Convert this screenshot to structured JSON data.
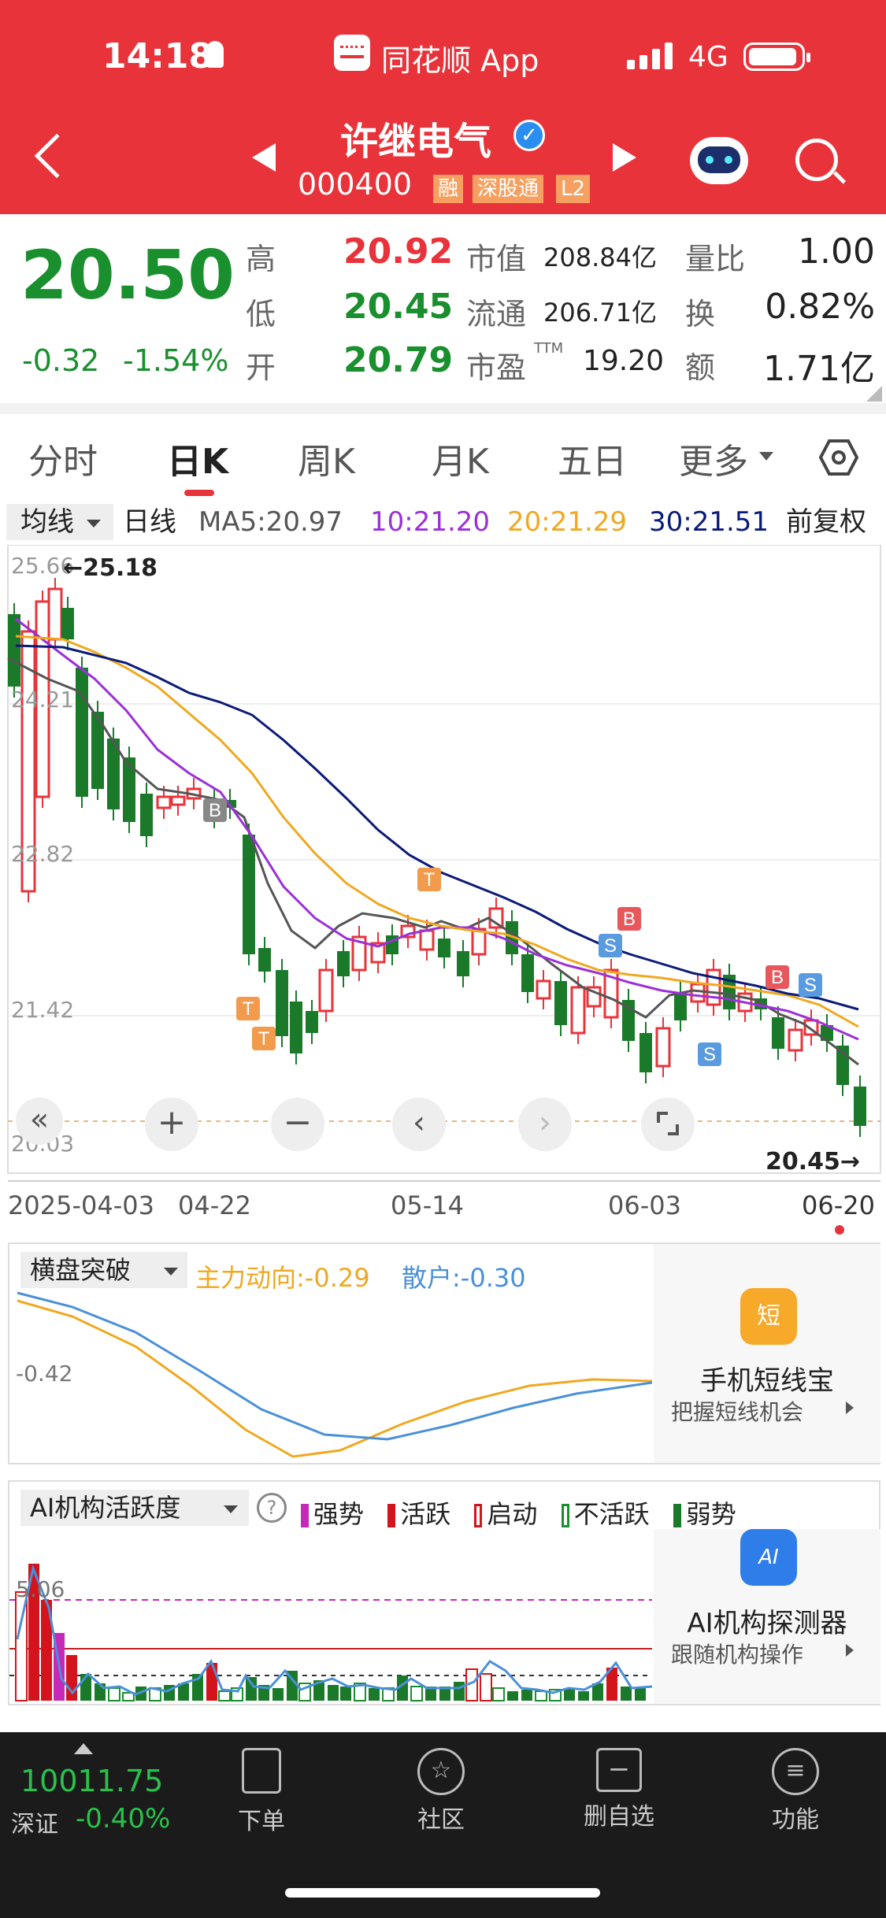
{
  "status_bar": {
    "time": "14:18",
    "app_name": "同花顺 App",
    "network": "4G"
  },
  "header": {
    "stock_name": "许继电气",
    "stock_code": "000400",
    "tags": [
      "融",
      "深股通",
      "L2"
    ]
  },
  "quote": {
    "price": "20.50",
    "change": "-0.32",
    "change_pct": "-1.54%",
    "high_label": "高",
    "high": "20.92",
    "low_label": "低",
    "low": "20.45",
    "open_label": "开",
    "open": "20.79",
    "mcap_label": "市值",
    "mcap": "208.84亿",
    "float_label": "流通",
    "float": "206.71亿",
    "pe_label": "市盈",
    "pe_sup": "TTM",
    "pe": "19.20",
    "vr_label": "量比",
    "vr": "1.00",
    "turnover_label": "换",
    "turnover": "0.82%",
    "amount_label": "额",
    "amount": "1.71亿"
  },
  "tabs": [
    "分时",
    "日K",
    "周K",
    "月K",
    "五日",
    "更多"
  ],
  "ma_row": {
    "selector": "均线",
    "daily": "日线",
    "ma5": "MA5:20.97",
    "ma10": "10:21.20",
    "ma20": "20:21.29",
    "ma30": "30:21.51",
    "adjust": "前复权"
  },
  "kchart": {
    "y_labels": [
      "25.66",
      "24.21",
      "22.82",
      "21.42",
      "20.03"
    ],
    "max_label": "←25.18",
    "min_label": "20.45→",
    "x_labels": [
      "2025-04-03",
      "04-22",
      "05-14",
      "06-03",
      "06-20"
    ]
  },
  "indicator1": {
    "selector": "横盘突破",
    "main_force": "主力动向:-0.29",
    "retail": "散户:-0.30",
    "y_label": "-0.42",
    "ad_title": "手机短线宝",
    "ad_sub": "把握短线机会",
    "ad_icon": "短"
  },
  "indicator2": {
    "selector": "AI机构活跃度",
    "help": "?",
    "legend": [
      "强势",
      "活跃",
      "启动",
      "不活跃",
      "弱势"
    ],
    "y_label": "5.06",
    "ad_title": "AI机构探测器",
    "ad_sub": "跟随机构操作",
    "ad_icon": "AI"
  },
  "bottom_bar": {
    "index_value": "10011.75",
    "index_name": "深证",
    "index_change": "-0.40%",
    "items": [
      "下单",
      "社区",
      "删自选",
      "功能"
    ]
  },
  "colors": {
    "up": "#e8333a",
    "down": "#1a8f2e",
    "ma5": "#555555",
    "ma10": "#9b30d9",
    "ma20": "#f0a820",
    "ma30": "#0a1a78"
  }
}
